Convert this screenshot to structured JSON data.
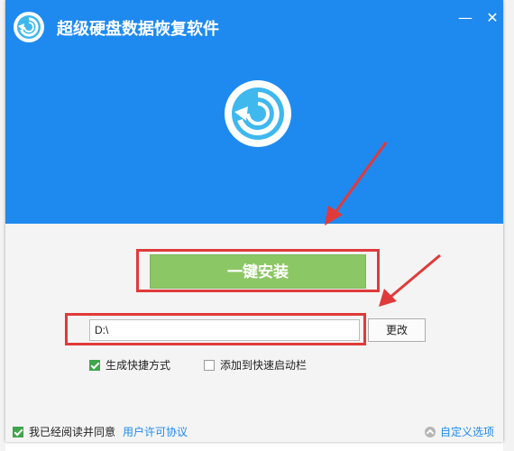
{
  "window": {
    "title": "超级硬盘数据恢复软件",
    "minimize_glyph": "—",
    "close_glyph": "✕"
  },
  "install": {
    "button_label": "一键安装"
  },
  "path": {
    "value": "D:\\",
    "change_label": "更改"
  },
  "options": [
    {
      "label": "生成快捷方式",
      "checked": true
    },
    {
      "label": "添加到快速启动栏",
      "checked": false
    }
  ],
  "agreement": {
    "text": "我已经阅读并同意",
    "link": "用户许可协议",
    "checked": true
  },
  "custom_options": {
    "label": "自定义选项"
  },
  "colors": {
    "header": "#1e8af0",
    "install_button": "#8cc766",
    "highlight": "#e03a3a",
    "link": "#1e8af0"
  },
  "icons": [
    "app-logo-icon",
    "minimize-icon",
    "close-icon",
    "checkbox-icon",
    "chevron-up-icon",
    "annotation-arrow-icon"
  ]
}
